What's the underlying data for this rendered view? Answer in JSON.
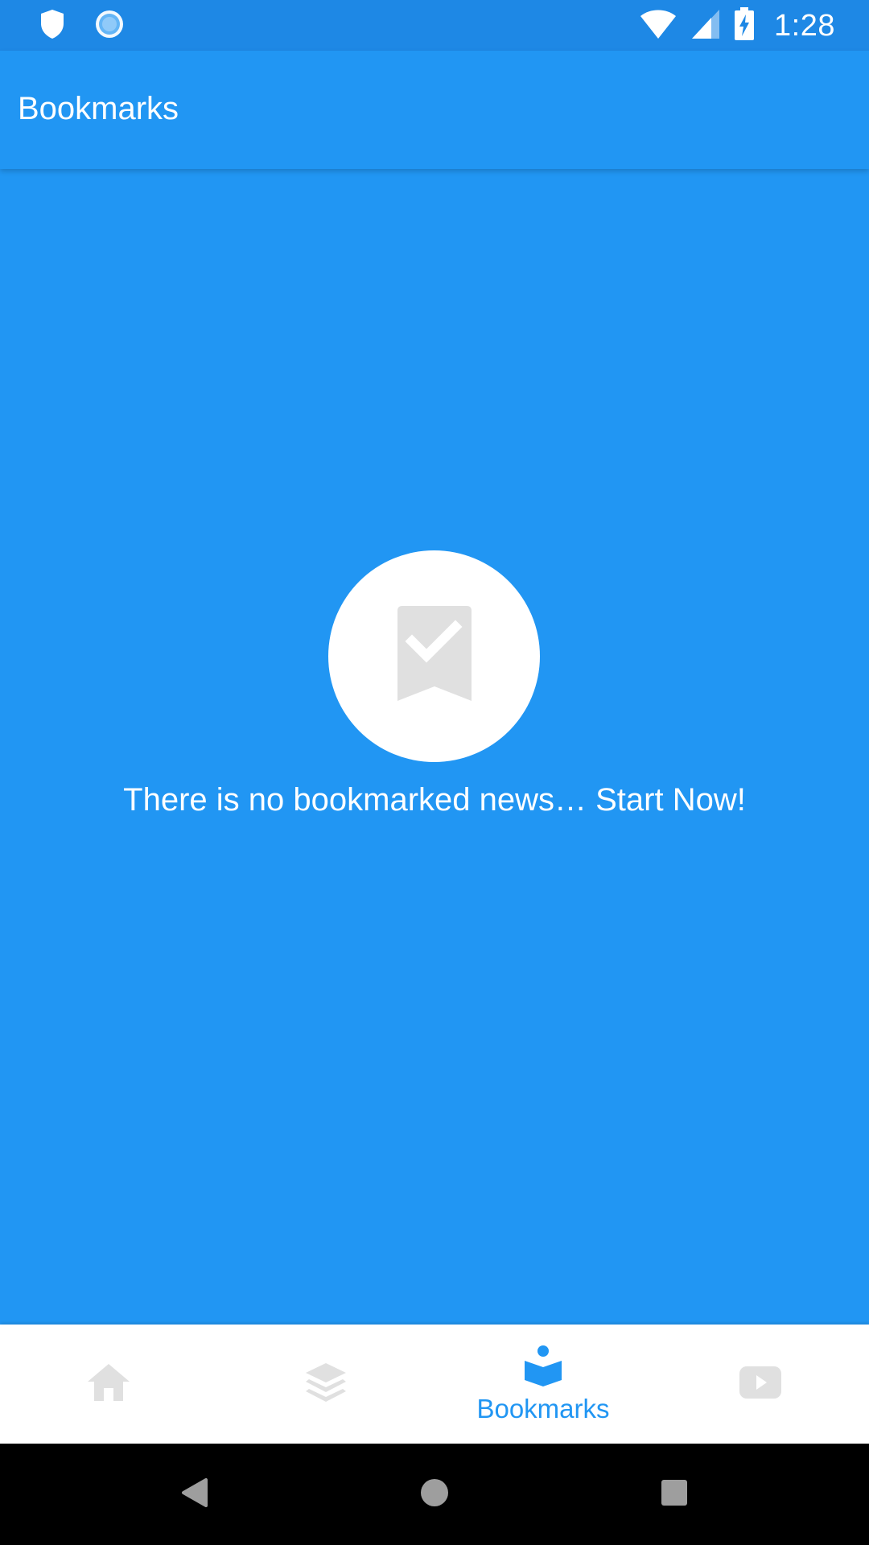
{
  "status_bar": {
    "time": "1:28",
    "icons": [
      "shield-icon",
      "sync-icon",
      "wifi-icon",
      "cell-signal-icon",
      "battery-charging-icon"
    ]
  },
  "app_bar": {
    "title": "Bookmarks"
  },
  "empty_state": {
    "icon": "bookmark-check-icon",
    "message": "There is no bookmarked news… Start Now!"
  },
  "bottom_nav": {
    "items": [
      {
        "icon": "home-icon",
        "label": "",
        "active": false
      },
      {
        "icon": "layers-icon",
        "label": "",
        "active": false
      },
      {
        "icon": "reader-bookmark-icon",
        "label": "Bookmarks",
        "active": true
      },
      {
        "icon": "video-play-icon",
        "label": "",
        "active": false
      }
    ],
    "active_color": "#2196F3",
    "inactive_color": "#E0E0E0"
  },
  "system_nav": {
    "buttons": [
      "back-icon",
      "home-circle-icon",
      "recents-icon"
    ]
  },
  "colors": {
    "primary": "#2196F3",
    "status_bar": "#1E88E5",
    "surface": "#FFFFFF",
    "icon_grey": "#E0E0E0"
  }
}
